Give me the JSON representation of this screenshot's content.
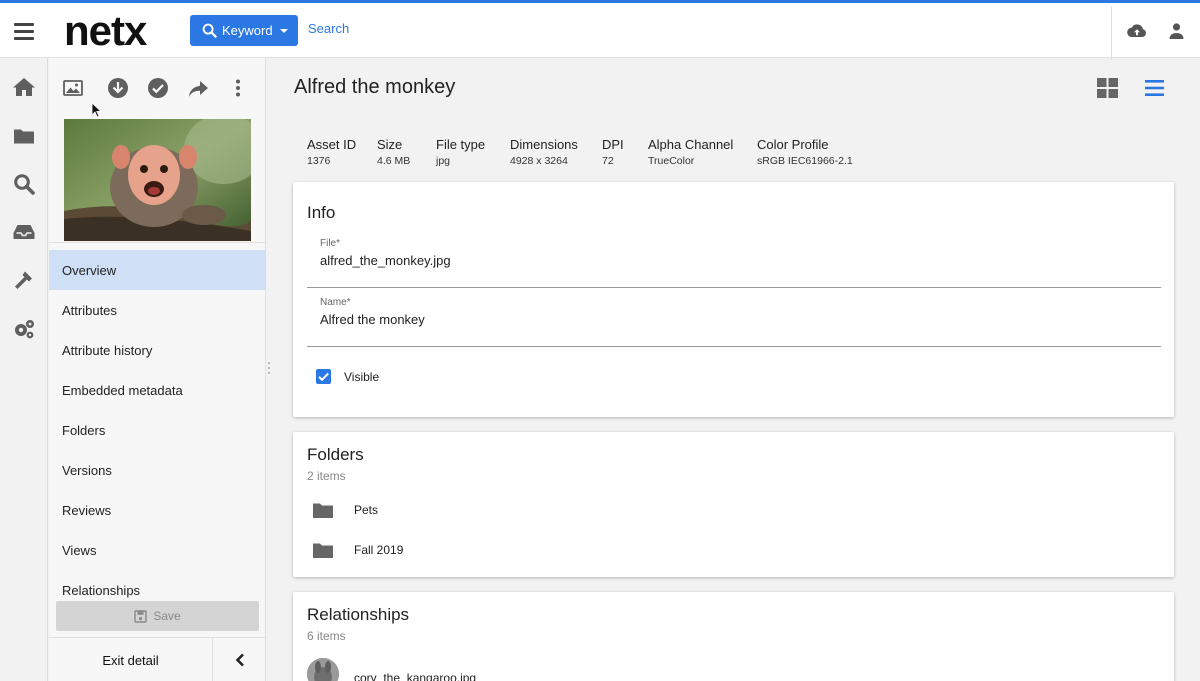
{
  "colors": {
    "accent": "#2b78e4",
    "active_nav": "#cfdff6",
    "icon_gray": "#5f5f5f"
  },
  "header": {
    "logo": "netx",
    "search_mode_label": "Keyword",
    "search_placeholder": "Search"
  },
  "rail": {
    "icons": [
      "home-icon",
      "folder-icon",
      "search-icon",
      "inbox-icon",
      "hammer-icon",
      "settings-icon"
    ]
  },
  "panel": {
    "toolbar_icons": [
      "image-icon",
      "download-icon",
      "check-circle-icon",
      "share-icon",
      "more-vert-icon"
    ],
    "nav": [
      {
        "label": "Overview",
        "active": true
      },
      {
        "label": "Attributes",
        "active": false
      },
      {
        "label": "Attribute history",
        "active": false
      },
      {
        "label": "Embedded metadata",
        "active": false
      },
      {
        "label": "Folders",
        "active": false
      },
      {
        "label": "Versions",
        "active": false
      },
      {
        "label": "Reviews",
        "active": false
      },
      {
        "label": "Views",
        "active": false
      },
      {
        "label": "Relationships",
        "active": false
      }
    ],
    "save_label": "Save",
    "exit_label": "Exit detail"
  },
  "main": {
    "title": "Alfred the monkey",
    "meta": [
      {
        "key": "Asset ID",
        "value": "1376"
      },
      {
        "key": "Size",
        "value": "4.6 MB"
      },
      {
        "key": "File type",
        "value": "jpg"
      },
      {
        "key": "Dimensions",
        "value": "4928 x 3264"
      },
      {
        "key": "DPI",
        "value": "72"
      },
      {
        "key": "Alpha Channel",
        "value": "TrueColor"
      },
      {
        "key": "Color Profile",
        "value": "sRGB IEC61966-2.1"
      }
    ],
    "info": {
      "title": "Info",
      "file_label": "File*",
      "file_value": "alfred_the_monkey.jpg",
      "name_label": "Name*",
      "name_value": "Alfred the monkey",
      "visible_label": "Visible",
      "visible_checked": true
    },
    "folders": {
      "title": "Folders",
      "count": "2 items",
      "items": [
        "Pets",
        "Fall 2019"
      ]
    },
    "relationships": {
      "title": "Relationships",
      "count": "6 items",
      "items": [
        "cory_the_kangaroo.jpg"
      ]
    }
  }
}
